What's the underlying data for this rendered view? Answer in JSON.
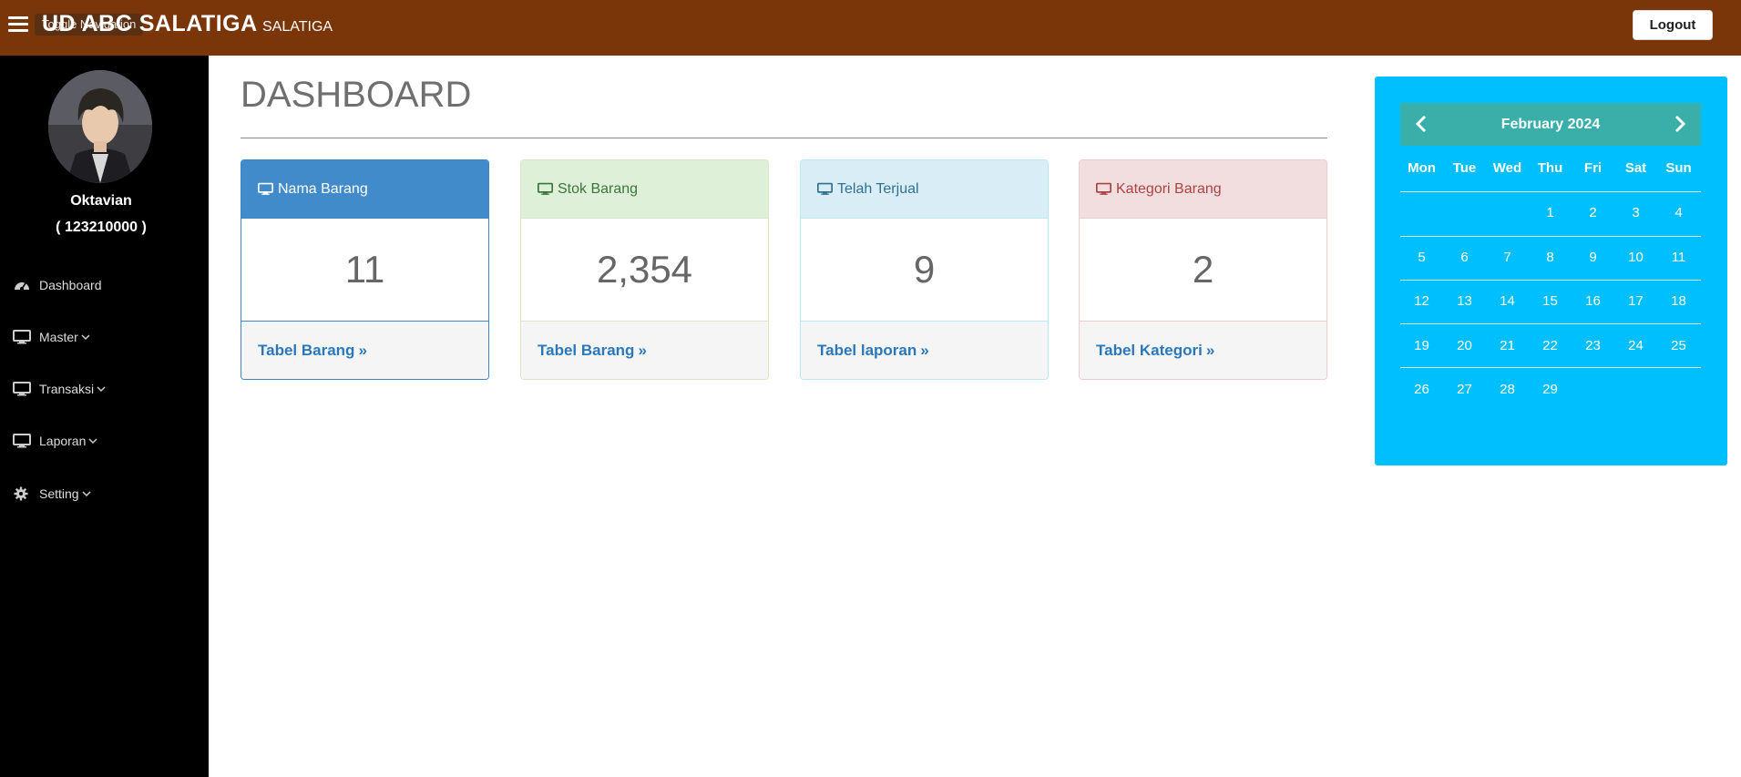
{
  "header": {
    "toggle_label": "Toggle Navigation",
    "brand": "UD ABC SALATIGA",
    "brand_sub": "SALATIGA",
    "logout_label": "Logout"
  },
  "sidebar": {
    "user_name": "Oktavian",
    "user_id": "( 123210000 )",
    "items": [
      {
        "label": "Dashboard",
        "icon": "dashboard-icon",
        "has_caret": false
      },
      {
        "label": "Master",
        "icon": "desktop-icon",
        "has_caret": true
      },
      {
        "label": "Transaksi",
        "icon": "desktop-icon",
        "has_caret": true
      },
      {
        "label": "Laporan",
        "icon": "desktop-icon",
        "has_caret": true
      },
      {
        "label": "Setting",
        "icon": "gear-icon",
        "has_caret": true
      }
    ]
  },
  "main": {
    "title": "DASHBOARD",
    "panels": [
      {
        "title": "Nama Barang",
        "value": "11",
        "link": "Tabel Barang",
        "color": "primary"
      },
      {
        "title": "Stok Barang",
        "value": "2,354",
        "link": "Tabel Barang",
        "color": "success"
      },
      {
        "title": "Telah Terjual",
        "value": "9",
        "link": "Tabel laporan",
        "color": "info"
      },
      {
        "title": "Kategori Barang",
        "value": "2",
        "link": "Tabel Kategori",
        "color": "danger"
      }
    ]
  },
  "calendar": {
    "month_label": "February 2024",
    "weekdays": [
      "Mon",
      "Tue",
      "Wed",
      "Thu",
      "Fri",
      "Sat",
      "Sun"
    ],
    "weeks": [
      [
        "",
        "",
        "",
        "1",
        "2",
        "3",
        "4"
      ],
      [
        "5",
        "6",
        "7",
        "8",
        "9",
        "10",
        "11"
      ],
      [
        "12",
        "13",
        "14",
        "15",
        "16",
        "17",
        "18"
      ],
      [
        "19",
        "20",
        "21",
        "22",
        "23",
        "24",
        "25"
      ],
      [
        "26",
        "27",
        "28",
        "29",
        "",
        "",
        ""
      ]
    ]
  },
  "colors": {
    "topbar": "#7a3509",
    "sidebar": "#000000",
    "calendar_bg": "#00bfff",
    "calendar_header": "#3aafa9",
    "link": "#2a78bb"
  }
}
